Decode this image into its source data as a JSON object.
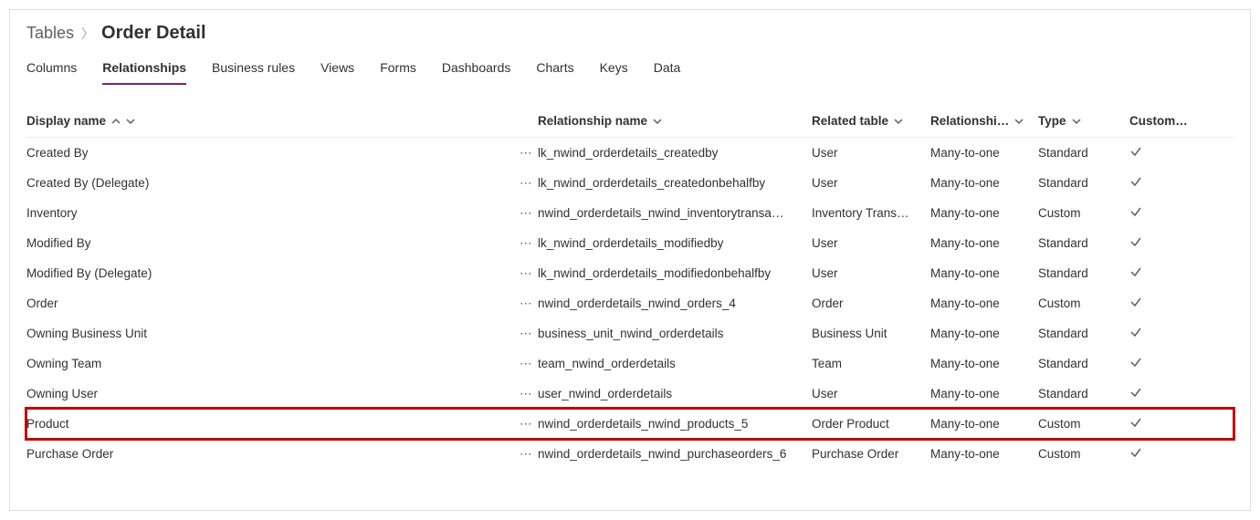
{
  "breadcrumb": {
    "parent": "Tables",
    "current": "Order Detail"
  },
  "tabs": [
    {
      "label": "Columns",
      "active": false
    },
    {
      "label": "Relationships",
      "active": true
    },
    {
      "label": "Business rules",
      "active": false
    },
    {
      "label": "Views",
      "active": false
    },
    {
      "label": "Forms",
      "active": false
    },
    {
      "label": "Dashboards",
      "active": false
    },
    {
      "label": "Charts",
      "active": false
    },
    {
      "label": "Keys",
      "active": false
    },
    {
      "label": "Data",
      "active": false
    }
  ],
  "columns": {
    "display_name": "Display name",
    "relationship_name": "Relationship name",
    "related_table": "Related table",
    "relationship_type": "Relationshi…",
    "type": "Type",
    "customizable": "Custom…"
  },
  "rows": [
    {
      "display": "Created By",
      "rel": "lk_nwind_orderdetails_createdby",
      "table": "User",
      "reltype": "Many-to-one",
      "type": "Standard",
      "custom": true,
      "highlighted": false
    },
    {
      "display": "Created By (Delegate)",
      "rel": "lk_nwind_orderdetails_createdonbehalfby",
      "table": "User",
      "reltype": "Many-to-one",
      "type": "Standard",
      "custom": true,
      "highlighted": false
    },
    {
      "display": "Inventory",
      "rel": "nwind_orderdetails_nwind_inventorytransa…",
      "table": "Inventory Trans…",
      "reltype": "Many-to-one",
      "type": "Custom",
      "custom": true,
      "highlighted": false
    },
    {
      "display": "Modified By",
      "rel": "lk_nwind_orderdetails_modifiedby",
      "table": "User",
      "reltype": "Many-to-one",
      "type": "Standard",
      "custom": true,
      "highlighted": false
    },
    {
      "display": "Modified By (Delegate)",
      "rel": "lk_nwind_orderdetails_modifiedonbehalfby",
      "table": "User",
      "reltype": "Many-to-one",
      "type": "Standard",
      "custom": true,
      "highlighted": false
    },
    {
      "display": "Order",
      "rel": "nwind_orderdetails_nwind_orders_4",
      "table": "Order",
      "reltype": "Many-to-one",
      "type": "Custom",
      "custom": true,
      "highlighted": false
    },
    {
      "display": "Owning Business Unit",
      "rel": "business_unit_nwind_orderdetails",
      "table": "Business Unit",
      "reltype": "Many-to-one",
      "type": "Standard",
      "custom": true,
      "highlighted": false
    },
    {
      "display": "Owning Team",
      "rel": "team_nwind_orderdetails",
      "table": "Team",
      "reltype": "Many-to-one",
      "type": "Standard",
      "custom": true,
      "highlighted": false
    },
    {
      "display": "Owning User",
      "rel": "user_nwind_orderdetails",
      "table": "User",
      "reltype": "Many-to-one",
      "type": "Standard",
      "custom": true,
      "highlighted": false
    },
    {
      "display": "Product",
      "rel": "nwind_orderdetails_nwind_products_5",
      "table": "Order Product",
      "reltype": "Many-to-one",
      "type": "Custom",
      "custom": true,
      "highlighted": true
    },
    {
      "display": "Purchase Order",
      "rel": "nwind_orderdetails_nwind_purchaseorders_6",
      "table": "Purchase Order",
      "reltype": "Many-to-one",
      "type": "Custom",
      "custom": true,
      "highlighted": false
    }
  ]
}
